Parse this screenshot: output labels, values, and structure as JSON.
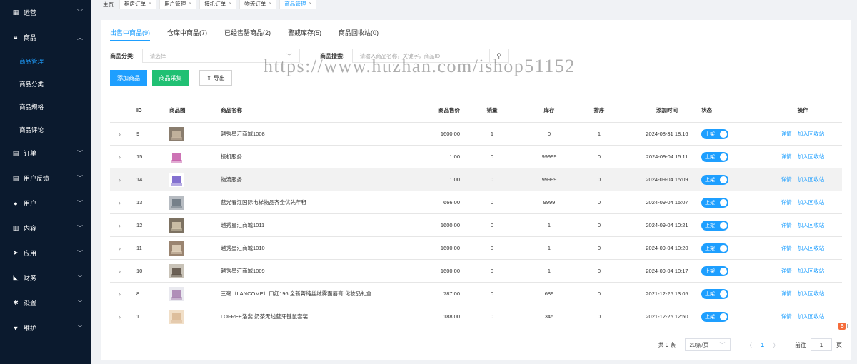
{
  "sidebar": {
    "menu": [
      {
        "label": "运营",
        "icon": "grid-icon",
        "chev": "﹀"
      },
      {
        "label": "商品",
        "icon": "bag-icon",
        "chev": "︿"
      },
      {
        "label": "订单",
        "icon": "doc-icon",
        "chev": "﹀"
      },
      {
        "label": "用户反馈",
        "icon": "doc-icon",
        "chev": "﹀"
      },
      {
        "label": "用户",
        "icon": "user-icon",
        "chev": "﹀"
      },
      {
        "label": "内容",
        "icon": "book-icon",
        "chev": "﹀"
      },
      {
        "label": "应用",
        "icon": "send-icon",
        "chev": "﹀"
      },
      {
        "label": "财务",
        "icon": "wallet-icon",
        "chev": "﹀"
      },
      {
        "label": "设置",
        "icon": "gear-icon",
        "chev": "﹀"
      },
      {
        "label": "维护",
        "icon": "tool-icon",
        "chev": "﹀"
      }
    ],
    "submenu": [
      "商品管理",
      "商品分类",
      "商品规格",
      "商品评论"
    ]
  },
  "tabs": {
    "home": "主页",
    "items": [
      "租房订单",
      "用户管理",
      "接机订单",
      "物流订单",
      "商品管理"
    ],
    "close": "×"
  },
  "subtabs": [
    "出售中商品(9)",
    "仓库中商品(7)",
    "已经售罄商品(2)",
    "警戒库存(5)",
    "商品回收站(0)"
  ],
  "filter": {
    "category_label": "商品分类:",
    "category_placeholder": "请选择",
    "search_label": "商品搜索:",
    "search_placeholder": "请输入商品名称，关键字，商品ID"
  },
  "buttons": {
    "add": "添加商品",
    "collect": "商品采集",
    "export": "导出"
  },
  "watermark": "https://www.huzhan.com/ishop51152",
  "table": {
    "headers": {
      "id": "ID",
      "img": "商品图",
      "name": "商品名称",
      "price": "商品售价",
      "sales": "销量",
      "stock": "库存",
      "sort": "排序",
      "time": "添加时间",
      "status": "状态",
      "ops": "操作"
    },
    "rows": [
      {
        "id": "9",
        "name": "越秀星汇商城1008",
        "price": "1600.00",
        "sales": "1",
        "stock": "0",
        "sort": "1",
        "time": "2024-08-31 18:16",
        "status": "上架"
      },
      {
        "id": "15",
        "name": "接机服务",
        "price": "1.00",
        "sales": "0",
        "stock": "99999",
        "sort": "0",
        "time": "2024-09-04 15:11",
        "status": "上架"
      },
      {
        "id": "14",
        "name": "物流服务",
        "price": "1.00",
        "sales": "0",
        "stock": "99999",
        "sort": "0",
        "time": "2024-09-04 15:09",
        "status": "上架"
      },
      {
        "id": "13",
        "name": "蓝光春江国际电梯物品齐全优先年租",
        "price": "666.00",
        "sales": "0",
        "stock": "9999",
        "sort": "0",
        "time": "2024-09-04 15:07",
        "status": "上架"
      },
      {
        "id": "12",
        "name": "越秀星汇商城1011",
        "price": "1600.00",
        "sales": "0",
        "stock": "1",
        "sort": "0",
        "time": "2024-09-04 10:21",
        "status": "上架"
      },
      {
        "id": "11",
        "name": "越秀星汇商城1010",
        "price": "1600.00",
        "sales": "0",
        "stock": "1",
        "sort": "0",
        "time": "2024-09-04 10:20",
        "status": "上架"
      },
      {
        "id": "10",
        "name": "越秀星汇商城1009",
        "price": "1600.00",
        "sales": "0",
        "stock": "1",
        "sort": "0",
        "time": "2024-09-04 10:17",
        "status": "上架"
      },
      {
        "id": "8",
        "name": "三毫（LANCOME）口红196 全新菁纯丝绒雾面唇膏 化妆品礼盒",
        "price": "787.00",
        "sales": "0",
        "stock": "689",
        "sort": "0",
        "time": "2021-12-25 13:05",
        "status": "上架"
      },
      {
        "id": "1",
        "name": "LOFREE洛斐 奶茶无线蓝牙键鼠套装",
        "price": "188.00",
        "sales": "0",
        "stock": "345",
        "sort": "0",
        "time": "2021-12-25 12:50",
        "status": "上架"
      }
    ],
    "op_detail": "详情",
    "op_recycle": "加入回收站"
  },
  "pager": {
    "total": "共 9 条",
    "size": "20条/页",
    "page": "1",
    "goto": "前往",
    "goto_value": "1",
    "unit": "页"
  },
  "colors": {
    "sidebar": "#0b1a2e",
    "accent": "#1e9fff",
    "green": "#20c073"
  }
}
